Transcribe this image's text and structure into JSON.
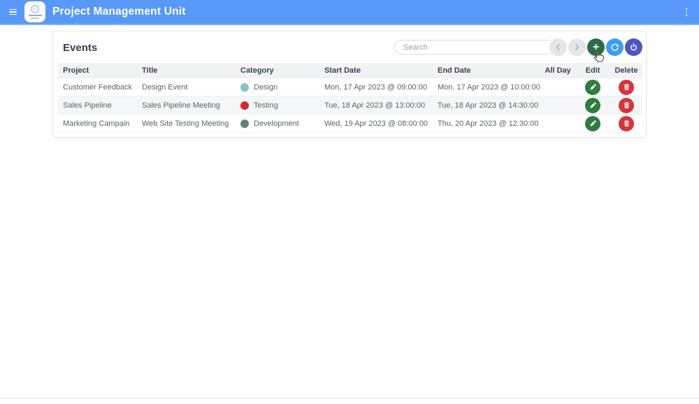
{
  "header": {
    "title": "Project Management Unit",
    "menu_icon": "hamburger-icon",
    "overflow_icon": "kebab-menu-icon"
  },
  "panel": {
    "title": "Events",
    "search": {
      "placeholder": "Search",
      "value": ""
    },
    "toolbar": {
      "add_label": "+",
      "icons": {
        "previous": "chevron-left-icon",
        "next": "chevron-right-icon",
        "add": "plus-icon",
        "refresh": "refresh-icon",
        "power": "power-icon"
      }
    }
  },
  "table": {
    "columns": {
      "project": "Project",
      "title": "Title",
      "category": "Category",
      "start": "Start Date",
      "end": "End Date",
      "all_day": "All Day",
      "edit": "Edit",
      "delete": "Delete"
    },
    "rows": [
      {
        "project": "Customer Feedback",
        "title": "Design Event",
        "category": "Design",
        "category_color": "#84c3c9",
        "start": "Mon, 17 Apr 2023 @ 09:00:00",
        "end": "Mon, 17 Apr 2023 @ 10:00:00",
        "all_day": false
      },
      {
        "project": "Sales Pipeline",
        "title": "Sales Pipeline Meeting",
        "category": "Testing",
        "category_color": "#d32b2b",
        "start": "Tue, 18 Apr 2023 @ 13:00:00",
        "end": "Tue, 18 Apr 2023 @ 14:30:00",
        "all_day": false
      },
      {
        "project": "Marketing Campain",
        "title": "Web Site Testing Meeting",
        "category": "Development",
        "category_color": "#5c8671",
        "start": "Wed, 19 Apr 2023 @ 08:00:00",
        "end": "Thu, 20 Apr 2023 @ 12:30:00",
        "all_day": false
      }
    ]
  },
  "colors": {
    "topbar_bg": "#5898f8",
    "add_button": "#2e6b45",
    "refresh_button": "#3d9df3",
    "power_button": "#4c57c2",
    "edit_button": "#2e7d3f",
    "delete_button": "#d7343c"
  }
}
